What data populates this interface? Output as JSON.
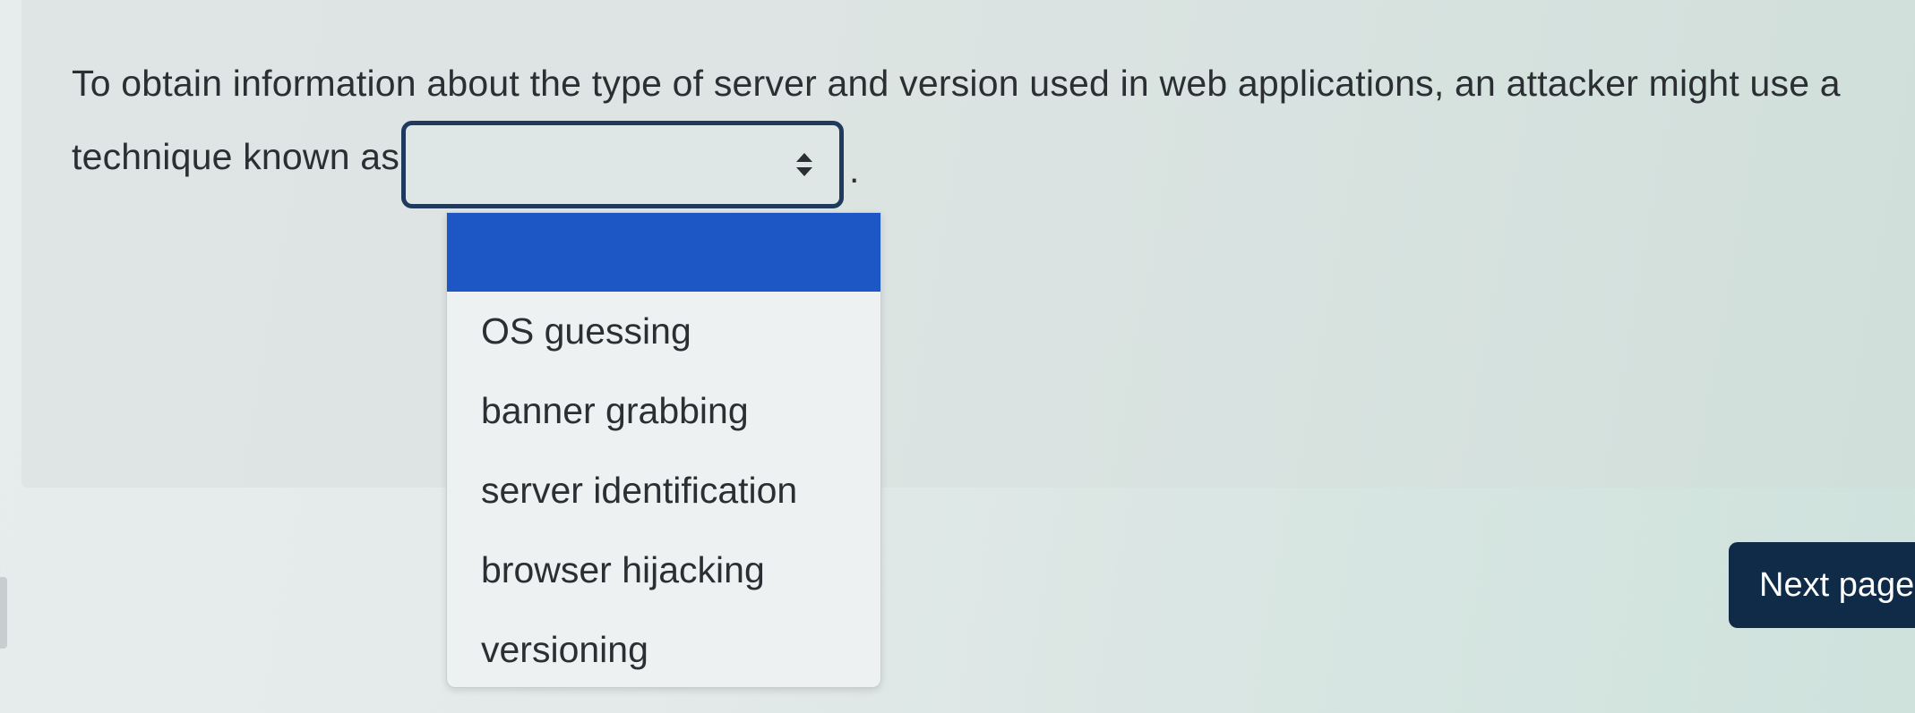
{
  "question": {
    "line1": "To obtain information about the type of server and version used in web applications, an attacker might use a",
    "line2_prefix": "technique known as",
    "line2_suffix": "."
  },
  "select": {
    "selected_value": "",
    "arrows_icon": "up-down-arrows-icon",
    "options": [
      "",
      "OS guessing",
      "banner grabbing",
      "server identification",
      "browser hijacking",
      "versioning"
    ],
    "highlight_color": "#1d57c6",
    "border_color": "#1f3a5c"
  },
  "navigation": {
    "next_label": "Next page",
    "button_color": "#0f2b47"
  }
}
